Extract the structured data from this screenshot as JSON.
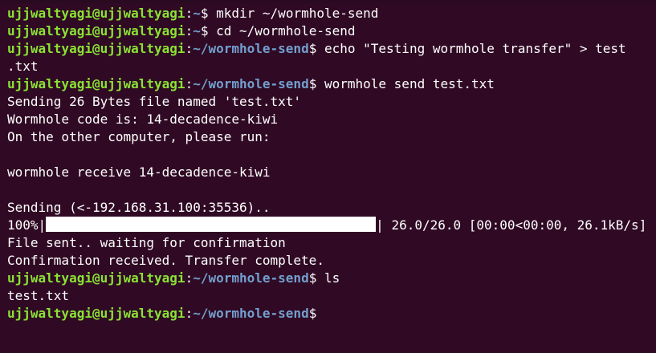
{
  "prompt": {
    "user_host": "ujjwaltyagi@ujjwaltyagi",
    "colon": ":",
    "home_path": "~",
    "project_path": "~/wormhole-send",
    "dollar": "$"
  },
  "commands": {
    "mkdir": " mkdir ~/wormhole-send",
    "cd": " cd ~/wormhole-send",
    "echo": " echo \"Testing wormhole transfer\" > test",
    "echo_cont": ".txt",
    "send": " wormhole send test.txt",
    "ls": " ls"
  },
  "output": {
    "sending": "Sending 26 Bytes file named 'test.txt'",
    "code": "Wormhole code is: 14-decadence-kiwi",
    "instruction": "On the other computer, please run:",
    "receive": "wormhole receive 14-decadence-kiwi",
    "sending_addr": "Sending (<-192.168.31.100:35536)..",
    "progress_left": "100%|",
    "progress_right": "| 26.0/26.0 [00:00<00:00, 26.1kB/s]",
    "file_sent": "File sent.. waiting for confirmation",
    "confirmed": "Confirmation received. Transfer complete.",
    "ls_result": "test.txt"
  },
  "progress": {
    "percent": 100
  },
  "colors": {
    "background": "#300a24",
    "user_host": "#8ae234",
    "path": "#729fcf",
    "text": "#ffffff"
  }
}
